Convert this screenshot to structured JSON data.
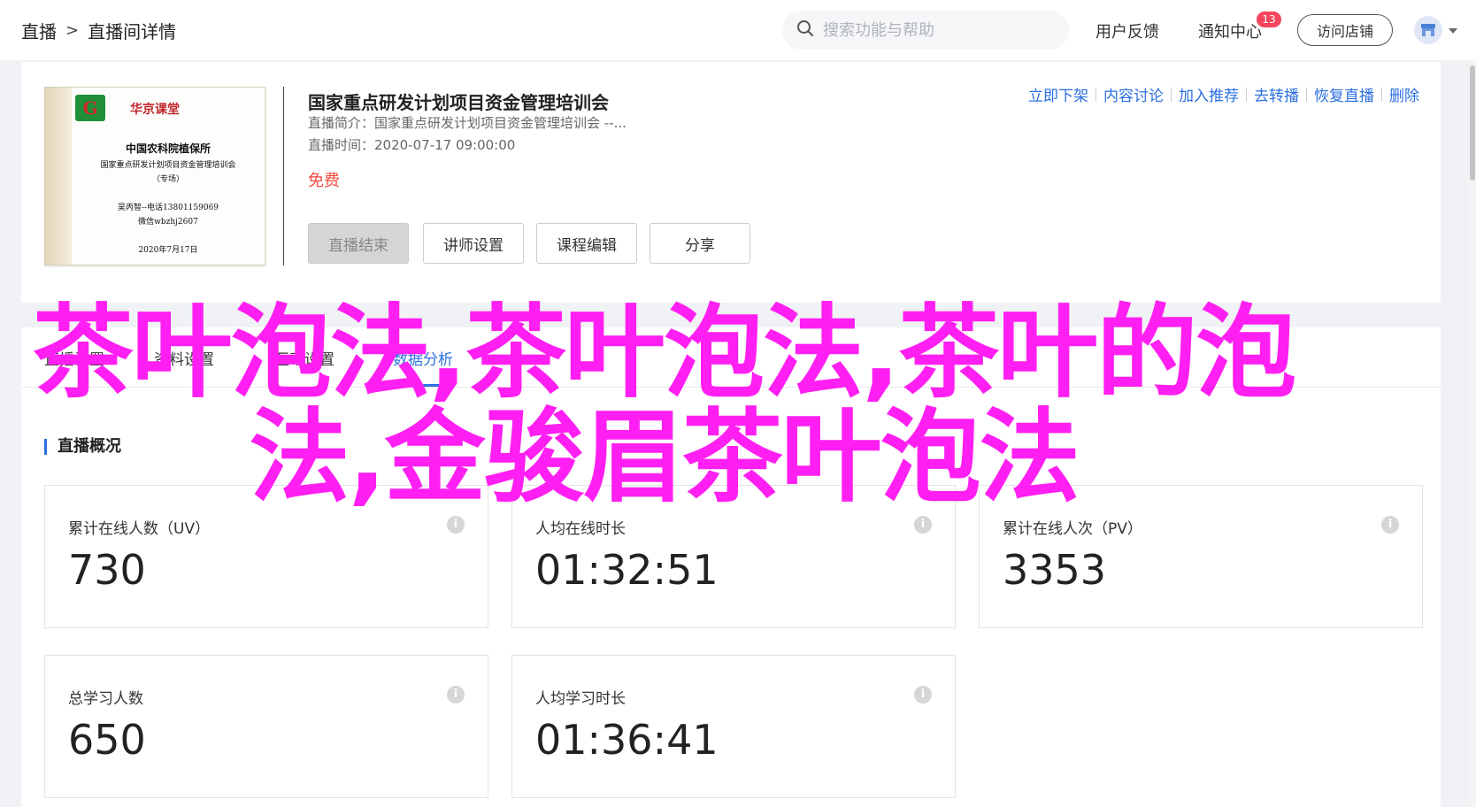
{
  "breadcrumb": {
    "root": "直播",
    "separator": ">",
    "current": "直播间详情"
  },
  "search": {
    "placeholder": "搜索功能与帮助"
  },
  "top_links": {
    "feedback": "用户反馈",
    "notifications": "通知中心",
    "notification_count": "13",
    "visit_store": "访问店铺"
  },
  "course": {
    "title": "国家重点研发计划项目资金管理培训会",
    "intro": "直播简介：国家重点研发计划项目资金管理培训会 --...",
    "time": "直播时间：2020-07-17 09:00:00",
    "price": "免费",
    "buttons": {
      "end_live": "直播结束",
      "lecturer": "讲师设置",
      "edit_course": "课程编辑",
      "share": "分享"
    },
    "actions": [
      "立即下架",
      "内容讨论",
      "加入推荐",
      "去转播",
      "恢复直播",
      "删除"
    ]
  },
  "certificate": {
    "logo_letter": "G",
    "brand": "华京课堂",
    "org": "中国农科院植保所",
    "line1": "国家重点研发计划项目资金管理培训会",
    "line2": "（专场）",
    "line3": "吴丙智--电话13801159069",
    "line4": "微信wbzhj2607",
    "date": "2020年7月17日"
  },
  "tabs": [
    "直播设置",
    "资料设置",
    "互动设置",
    "数据分析"
  ],
  "overview": {
    "title": "直播概况",
    "stats": [
      {
        "label": "累计在线人数（UV）",
        "value": "730"
      },
      {
        "label": "人均在线时长",
        "value": "01:32:51"
      },
      {
        "label": "累计在线人次（PV）",
        "value": "3353"
      },
      {
        "label": "总学习人数",
        "value": "650"
      },
      {
        "label": "人均学习时长",
        "value": "01:36:41"
      }
    ]
  },
  "overlay_text": "茶叶泡法,茶叶泡法,茶叶的泡法,金骏眉茶叶泡法",
  "colors": {
    "accent": "#2c6fe0",
    "price": "#f04a3e",
    "overlay": "#ff1ff2",
    "badge": "#f5455c"
  }
}
